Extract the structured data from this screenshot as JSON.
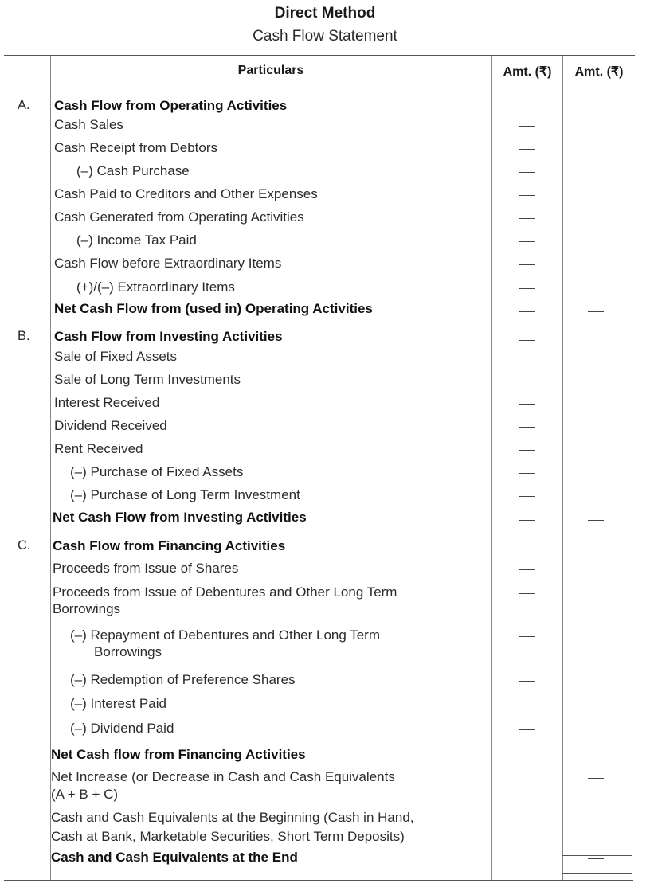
{
  "title": "Direct Method",
  "subtitle": "Cash Flow Statement",
  "table": {
    "headers": {
      "particulars": "Particulars",
      "amt1": "Amt. (₹)",
      "amt2": "Amt. (₹)"
    },
    "sections": [
      {
        "label": "A."
      },
      {
        "label": "B."
      },
      {
        "label": "C."
      }
    ],
    "rows": [
      {
        "text": "Cash Flow from Operating Activities",
        "bold": true
      },
      {
        "text": "Cash Sales",
        "amt1": "—"
      },
      {
        "text": "Cash Receipt from Debtors",
        "amt1": "—"
      },
      {
        "text": "(–)  Cash Purchase",
        "amt1": "—"
      },
      {
        "text": "Cash Paid to Creditors and Other Expenses",
        "amt1": "—"
      },
      {
        "text": "Cash Generated from Operating Activities",
        "amt1": "—"
      },
      {
        "text": "(–)  Income Tax Paid",
        "amt1": "—"
      },
      {
        "text": "Cash Flow before Extraordinary Items",
        "amt1": "—"
      },
      {
        "text": "(+)/(–)  Extraordinary Items",
        "amt1": "—"
      },
      {
        "text": "Net Cash Flow from (used in) Operating Activities",
        "bold": true,
        "amt1": "—",
        "amt2": "—"
      },
      {
        "text": "Cash Flow from Investing Activities",
        "bold": true,
        "amt1": "—"
      },
      {
        "text": "Sale of Fixed Assets",
        "amt1": "—"
      },
      {
        "text": "Sale of Long Term Investments",
        "amt1": "—"
      },
      {
        "text": "Interest Received",
        "amt1": "—"
      },
      {
        "text": "Dividend Received",
        "amt1": "—"
      },
      {
        "text": "Rent Received",
        "amt1": "—"
      },
      {
        "text": "(–)  Purchase of Fixed Assets",
        "amt1": "—"
      },
      {
        "text": "(–)  Purchase of Long Term Investment",
        "amt1": "—"
      },
      {
        "text": "Net Cash Flow from Investing Activities",
        "bold": true,
        "amt1": "—",
        "amt2": "—"
      },
      {
        "text": "Cash Flow from Financing Activities",
        "bold": true
      },
      {
        "text": "Proceeds from Issue of Shares",
        "amt1": "—"
      },
      {
        "text": "Proceeds from Issue of Debentures and Other Long Term",
        "amt1": "—"
      },
      {
        "text": "Borrowings"
      },
      {
        "text": "(–)  Repayment of Debentures and Other Long Term",
        "amt1": "—"
      },
      {
        "text": "Borrowings"
      },
      {
        "text": "(–)  Redemption of Preference Shares",
        "amt1": "—"
      },
      {
        "text": "(–)  Interest Paid",
        "amt1": "—"
      },
      {
        "text": "(–)  Dividend Paid",
        "amt1": "—"
      },
      {
        "text": "Net Cash flow from Financing Activities",
        "bold": true,
        "amt1": "—",
        "amt2": "—"
      },
      {
        "text": "Net Increase (or Decrease in Cash and Cash Equivalents",
        "amt2": "—"
      },
      {
        "text": "(A + B + C)"
      },
      {
        "text": "Cash and Cash Equivalents at the Beginning (Cash in Hand,",
        "amt2": "—"
      },
      {
        "text": "Cash at Bank, Marketable Securities, Short Term Deposits)"
      },
      {
        "text": "Cash and Cash Equivalents at the End",
        "bold": true,
        "amt2": "—"
      }
    ]
  }
}
